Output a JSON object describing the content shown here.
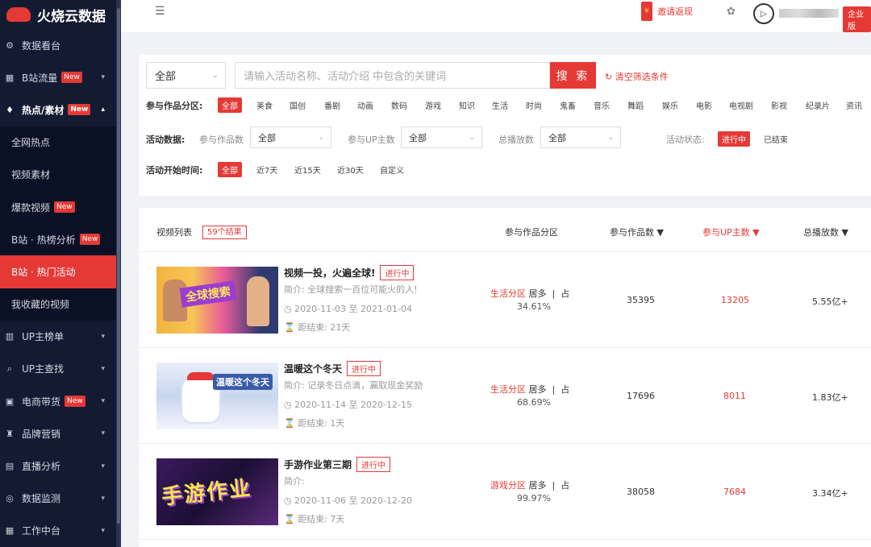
{
  "app": {
    "title": "火烧云数据"
  },
  "sidebar": {
    "items": [
      {
        "label": "数据看台",
        "icon": "gear-icon"
      },
      {
        "label": "B站流量",
        "icon": "chart-icon",
        "badge": "New"
      },
      {
        "label": "热点/素材",
        "icon": "fire-icon",
        "badge": "New"
      },
      {
        "label": "全网热点"
      },
      {
        "label": "视频素材"
      },
      {
        "label": "爆款视频",
        "badge": "New"
      },
      {
        "label": "B站 · 热榜分析",
        "badge": "New"
      },
      {
        "label": "B站 · 热门活动"
      },
      {
        "label": "我收藏的视频"
      },
      {
        "label": "UP主榜单",
        "icon": "bars-icon"
      },
      {
        "label": "UP主查找",
        "icon": "search-icon"
      },
      {
        "label": "电商带货",
        "icon": "cart-icon",
        "badge": "New"
      },
      {
        "label": "品牌营销",
        "icon": "megaphone-icon"
      },
      {
        "label": "直播分析",
        "icon": "tv-icon"
      },
      {
        "label": "数据监测",
        "icon": "target-icon"
      },
      {
        "label": "工作中台",
        "icon": "grid-icon"
      }
    ]
  },
  "topbar": {
    "invite": "邀请返现",
    "redpacket": "¥",
    "enterprise": "企业版"
  },
  "filters": {
    "category_select": "全部",
    "search_placeholder": "请输入活动名称、活动介绍 中包含的关键词",
    "search_button": "搜 索",
    "clear": "清空筛选条件",
    "zone_label": "参与作品分区:",
    "zones": [
      "全部",
      "美食",
      "国创",
      "番剧",
      "动画",
      "数码",
      "游戏",
      "知识",
      "生活",
      "时尚",
      "鬼畜",
      "音乐",
      "舞蹈",
      "娱乐",
      "电影",
      "电视剧",
      "影视",
      "纪录片",
      "资讯"
    ],
    "data_label": "活动数据:",
    "works_label": "参与作品数",
    "works_value": "全部",
    "up_label": "参与UP主数",
    "up_value": "全部",
    "plays_label": "总播放数",
    "plays_value": "全部",
    "status_label": "活动状态:",
    "status_active": "进行中",
    "status_ended": "已结束",
    "time_label": "活动开始时间:",
    "times": [
      "全部",
      "近7天",
      "近15天",
      "近30天",
      "自定义"
    ]
  },
  "list": {
    "title": "视频列表",
    "count": "59个结果",
    "col_zone": "参与作品分区",
    "col_works": "参与作品数 ▼",
    "col_up": "参与UP主数 ▼",
    "col_plays": "总播放数 ▼",
    "rows": [
      {
        "title": "视频一投，火遍全球!",
        "status": "进行中",
        "desc": "简介:  全球搜索一百位可能火的人!",
        "date": "2020-11-03 至 2021-01-04",
        "remain": "距结束:  21天",
        "zone": "生活分区",
        "zone_rank": "居多",
        "zone_share": "占",
        "zone_pct": "34.61%",
        "works": "35395",
        "ups": "13205",
        "plays": "5.55亿+",
        "thumb_text": "全球搜索"
      },
      {
        "title": "温暖这个冬天",
        "status": "进行中",
        "desc": "简介:  记录冬日点滴，赢取现金奖励",
        "date": "2020-11-14 至 2020-12-15",
        "remain": "距结束:  1天",
        "zone": "生活分区",
        "zone_rank": "居多",
        "zone_share": "占",
        "zone_pct": "68.69%",
        "works": "17696",
        "ups": "8011",
        "plays": "1.83亿+",
        "thumb_text": "温暖这个冬天"
      },
      {
        "title": "手游作业第三期",
        "status": "进行中",
        "desc": "简介:",
        "date": "2020-11-06 至 2020-12-20",
        "remain": "距结束:  7天",
        "zone": "游戏分区",
        "zone_rank": "居多",
        "zone_share": "占",
        "zone_pct": "99.97%",
        "works": "38058",
        "ups": "7684",
        "plays": "3.34亿+",
        "thumb_text": "手游作业"
      }
    ]
  }
}
